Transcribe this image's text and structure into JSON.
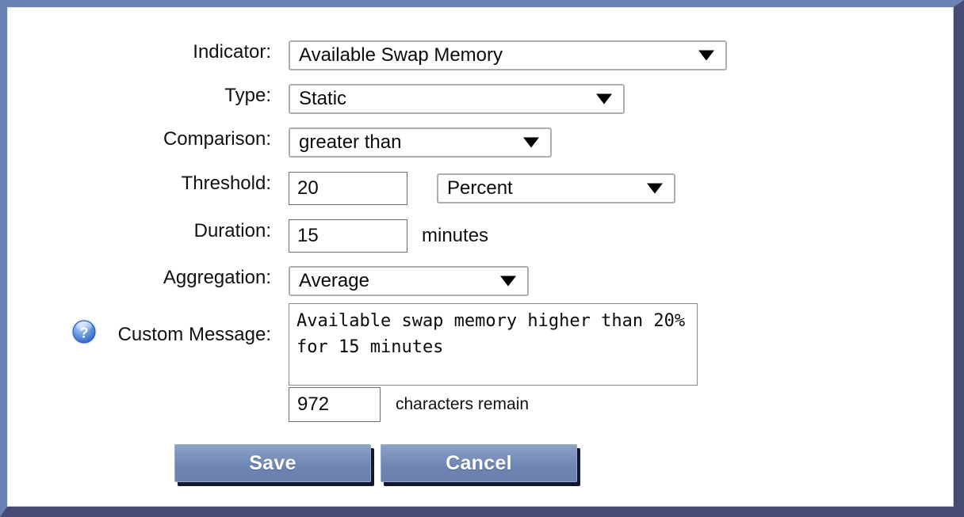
{
  "window": {
    "frame_color_light": "#6b82b4",
    "frame_color_dark": "#474a75",
    "panel_background": "#ffffff"
  },
  "form": {
    "rows": [
      {
        "label": "Indicator:",
        "control": "select",
        "value": "Available Swap Memory",
        "icon": "chevron-down-icon"
      },
      {
        "label": "Type:",
        "control": "select",
        "value": "Static",
        "icon": "chevron-down-icon"
      },
      {
        "label": "Comparison:",
        "control": "select",
        "value": "greater than",
        "icon": "chevron-down-icon"
      },
      {
        "label": "Threshold:",
        "control": "text+select",
        "value": "20",
        "unit_value": "Percent",
        "icon": "chevron-down-icon"
      },
      {
        "label": "Duration:",
        "control": "text",
        "value": "15",
        "suffix": "minutes"
      },
      {
        "label": "Aggregation:",
        "control": "select",
        "value": "Average",
        "icon": "chevron-down-icon"
      },
      {
        "label": "Custom Message:",
        "control": "textarea",
        "value": "Available swap memory higher than 20% for 15 minutes",
        "help_icon": "help-question-icon"
      }
    ],
    "char_count": {
      "value": "972",
      "suffix": "characters remain"
    }
  },
  "buttons": {
    "save_label": "Save",
    "cancel_label": "Cancel",
    "accent_color": "#6d84b2",
    "shadow_color": "#121833"
  }
}
